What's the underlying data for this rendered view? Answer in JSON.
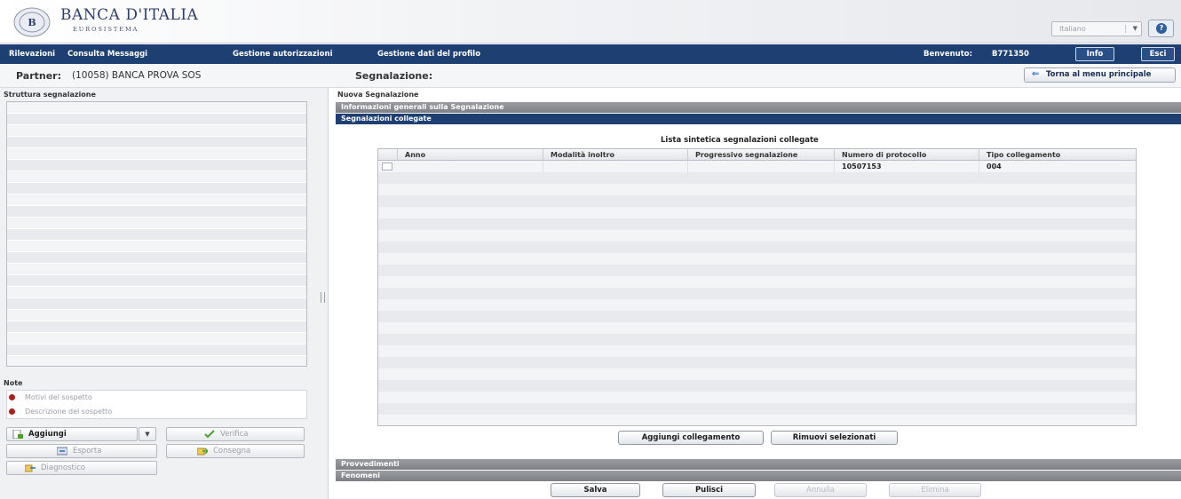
{
  "header": {
    "logo_title": "BANCA D'ITALIA",
    "logo_subtitle": "EUROSISTEMA",
    "language": "Italiano"
  },
  "nav": {
    "items": [
      "Rilevazioni",
      "Consulta Messaggi",
      "Gestione autorizzazioni",
      "Gestione dati del profilo"
    ],
    "welcome_label": "Benvenuto:",
    "user_code": "B771350",
    "info_label": "Info",
    "exit_label": "Esci"
  },
  "partner_row": {
    "partner_label": "Partner:",
    "partner_value": "(10058) BANCA PROVA SOS",
    "segnalazione_label": "Segnalazione:",
    "back_label": "Torna al menu principale"
  },
  "left": {
    "title": "Struttura segnalazione",
    "note_title": "Note",
    "notes": [
      "Motivi del sospetto",
      "Descrizione del sospetto"
    ],
    "buttons": {
      "aggiungi": "Aggiungi",
      "verifica": "Verifica",
      "esporta": "Esporta",
      "consegna": "Consegna",
      "diagnostico": "Diagnostico"
    }
  },
  "main": {
    "title": "Nuova Segnalazione",
    "section_info": "Informazioni generali sulla Segnalazione",
    "section_collegate": "Segnalazioni collegate",
    "list_title": "Lista sintetica segnalazioni collegate",
    "columns": [
      "Anno",
      "Modalità inoltro",
      "Progressivo segnalazione",
      "Numero di protocollo",
      "Tipo collegamento"
    ],
    "rows": [
      {
        "anno": "",
        "modalita": "",
        "progressivo": "",
        "protocollo": "10507153",
        "tipo": "004"
      }
    ],
    "add_link_label": "Aggiungi collegamento",
    "remove_selected_label": "Rimuovi selezionati",
    "section_provvedimenti": "Provvedimenti",
    "section_fenomeni": "Fenomeni",
    "actions": {
      "salva": "Salva",
      "pulisci": "Pulisci",
      "annulla": "Annulla",
      "elimina": "Elimina"
    }
  },
  "colors": {
    "nav_blue": "#1d3f72",
    "note_dot": "#b01e1e",
    "verify_green": "#4aa02c"
  }
}
